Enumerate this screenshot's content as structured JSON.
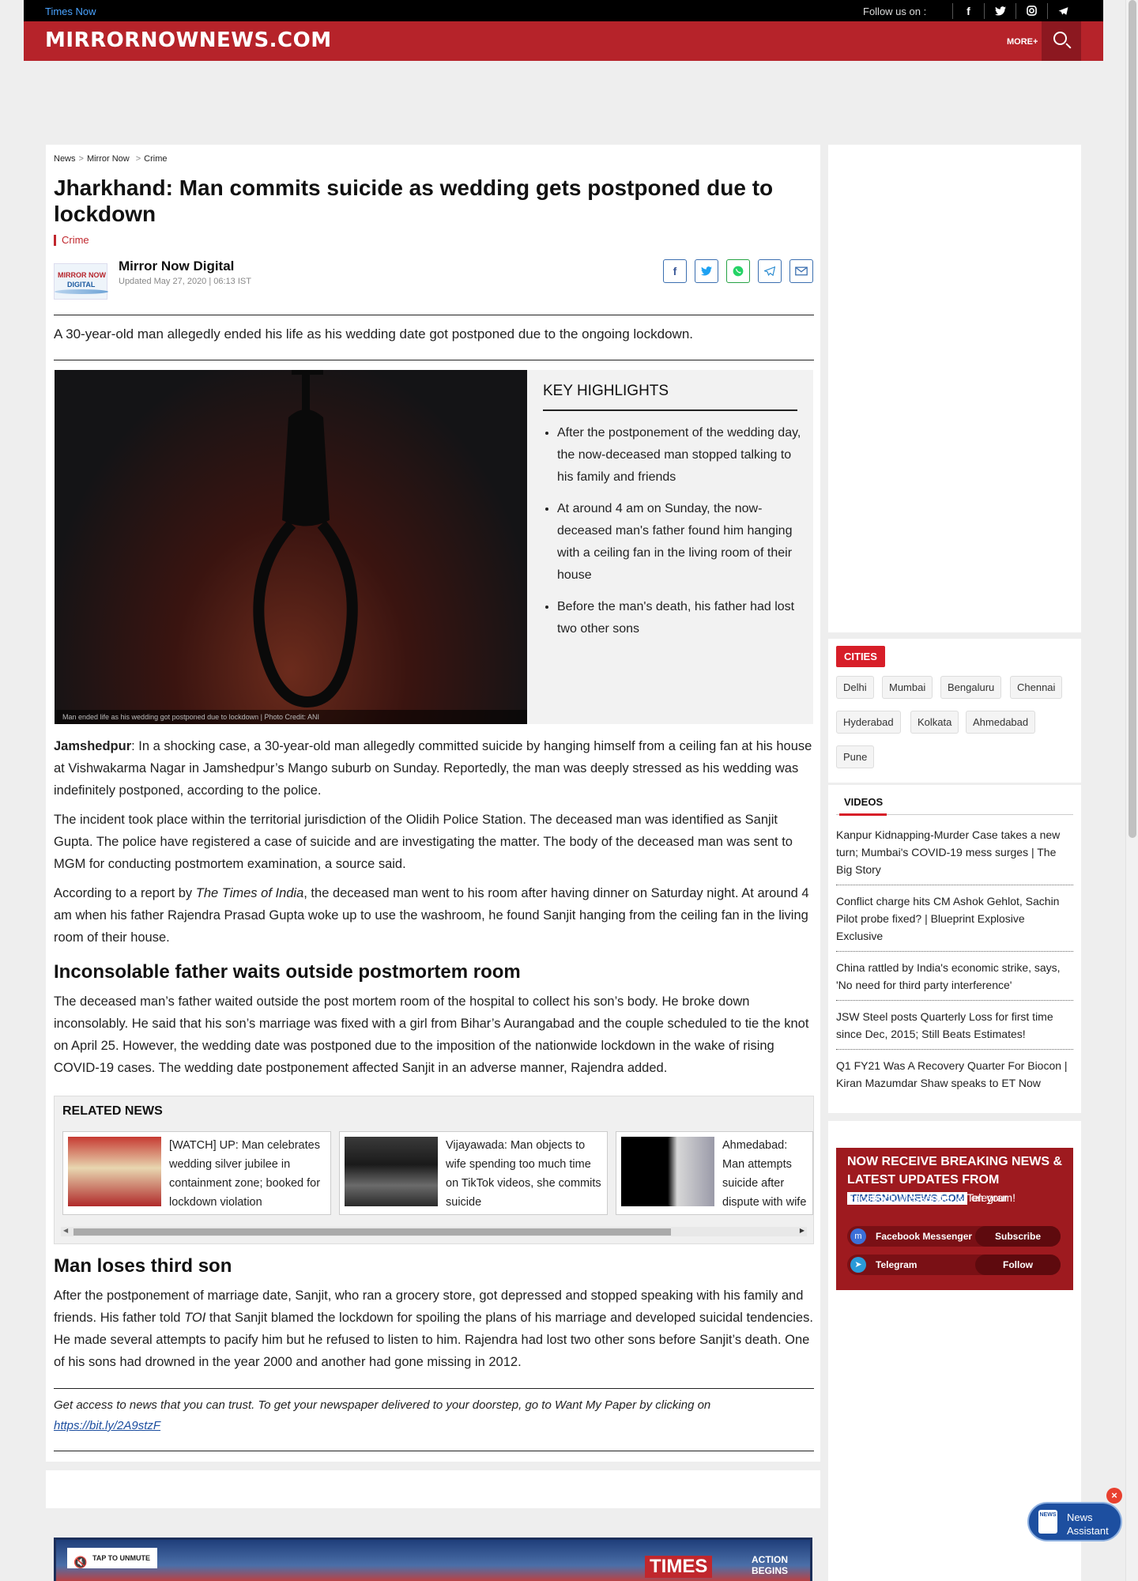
{
  "topbar": {
    "brand_link": "Times Now",
    "follow_label": "Follow us on :",
    "social": [
      "f",
      "t",
      "ig",
      "tg"
    ]
  },
  "header": {
    "logo": "MIRRORNOWNEWS.COM",
    "more_label": "MORE+"
  },
  "breadcrumb": [
    "News",
    "Mirror Now",
    "Crime"
  ],
  "article": {
    "title": "Jharkhand: Man commits suicide as wedding gets postponed due to lockdown",
    "category": "Crime",
    "author_logo_l1": "MIRROR NOW",
    "author_logo_l2": "DIGITAL",
    "author": "Mirror Now Digital",
    "updated": "Updated May 27, 2020 | 06:13 IST",
    "summary": "A 30-year-old man allegedly ended his life as his wedding date got postponed due to the ongoing lockdown.",
    "image_caption": "Man ended life as his wedding got postponed due to lockdown | Photo Credit: ANI",
    "highlights_title": "KEY HIGHLIGHTS",
    "highlights": [
      "After the postponement of the wedding day, the now-deceased man stopped talking to his family and friends",
      "At around 4 am on Sunday, the now-deceased man's father found him hanging with a ceiling fan in the living room of their house",
      "Before the man's death, his father had lost two other sons"
    ],
    "p1_lead": "Jamshedpur",
    "p1": ": In a shocking case, a 30-year-old man allegedly committed suicide by hanging himself from a ceiling fan at his house at Vishwakarma Nagar in Jamshedpur’s Mango suburb on Sunday. Reportedly, the man was deeply stressed as his wedding was indefinitely postponed, according to the police.",
    "p2": "The incident took place within the territorial jurisdiction of the Olidih Police Station. The deceased man was identified as Sanjit Gupta. The police have registered a case of suicide and are investigating the matter. The body of the deceased man was sent to MGM for conducting postmortem examination, a source said.",
    "p3_pre": "According to a report by ",
    "p3_em": "The Times of India",
    "p3_post": ", the deceased man went to his room after having dinner on Saturday night. At around 4 am when his father Rajendra Prasad Gupta woke up to use the washroom, he found Sanjit hanging from the ceiling fan in the living room of their house.",
    "h2_1": "Inconsolable father waits outside postmortem room",
    "p4": "The deceased man’s father waited outside the post mortem room of the hospital to collect his son’s body. He broke down inconsolably. He said that his son’s marriage was fixed with a girl from Bihar’s Aurangabad and the couple scheduled to tie the knot on April 25. However, the wedding date was postponed due to the imposition of the nationwide lockdown in the wake of rising COVID-19 cases. The wedding date postponement affected Sanjit in an adverse manner, Rajendra added.",
    "h2_2": "Man loses third son",
    "p5_pre": "After the postponement of marriage date, Sanjit, who ran a grocery store, got depressed and stopped speaking with his family and friends. His father told ",
    "p5_em": "TOI",
    "p5_post": " that Sanjit blamed the lockdown for spoiling the plans of his marriage and developed suicidal tendencies. He made several attempts to pacify him but he refused to listen to him. Rajendra had lost two other sons before Sanjit’s death. One of his sons had drowned in the year 2000 and another had gone missing in 2012.",
    "footnote": "Get access to news that you can trust. To get your newspaper delivered to your doorstep, go to Want My Paper by clicking on",
    "footnote_link": "https://bit.ly/2A9stzF"
  },
  "related": {
    "title": "RELATED NEWS",
    "items": [
      "[WATCH] UP: Man celebrates wedding silver jubilee in containment zone; booked for lockdown violation",
      "Vijayawada: Man objects to wife spending too much time on TikTok videos, she commits suicide",
      "Ahmedabad: Man attempts suicide after dispute with wife over lockdown | WATCH"
    ]
  },
  "video_ad": {
    "unmute": "TAP TO UNMUTE",
    "brand": "TIMES",
    "tag": "ACTION BEGINS"
  },
  "sidebar": {
    "cities_title": "CITIES",
    "cities": [
      "Delhi",
      "Mumbai",
      "Bengaluru",
      "Chennai",
      "Hyderabad",
      "Kolkata",
      "Ahmedabad",
      "Pune"
    ],
    "videos_title": "VIDEOS",
    "videos": [
      "Kanpur Kidnapping-Murder Case takes a new turn; Mumbai's COVID-19 mess surges | The Big Story",
      "Conflict charge hits CM Ashok Gehlot, Sachin Pilot probe fixed? | Blueprint Explosive Exclusive",
      "China rattled by India's economic strike, says, 'No need for third party interference'",
      "JSW Steel posts Quarterly Loss for first time since Dec, 2015; Still Beats Estimates!",
      "Q1 FY21 Was A Recovery Quarter For Biocon | Kiran Mazumdar Shaw speaks to ET Now"
    ],
    "promo_title": "NOW RECEIVE BREAKING NEWS & LATEST UPDATES FROM",
    "promo_logo": "TIMESNOWNEWS.COM",
    "promo_on": "on your",
    "promo_line": "Facebook Messenger & Telegram!",
    "messenger_label": "Facebook Messenger",
    "messenger_btn": "Subscribe",
    "telegram_label": "Telegram",
    "telegram_btn": "Follow"
  },
  "assistant": {
    "icon_text": "NEWS",
    "label_1": "News",
    "label_2": "Assistant"
  }
}
